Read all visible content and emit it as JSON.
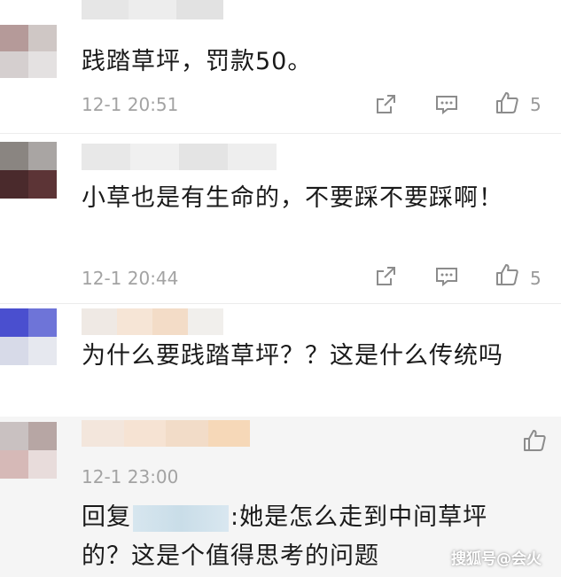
{
  "comments": [
    {
      "text": "践踏草坪，罚款50。",
      "time": "12-1 20:51",
      "like_count": "5"
    },
    {
      "text": "小草也是有生命的，不要踩不要踩啊！",
      "time": "12-1 20:44",
      "like_count": "5"
    },
    {
      "text": "为什么要践踏草坪？？这是什么传统吗"
    }
  ],
  "reply": {
    "time": "12-1 23:00",
    "prefix": "回复",
    "text": ":她是怎么走到中间草坪的？这是个值得思考的问题"
  },
  "icons": {
    "share": "share-icon",
    "comment": "comment-icon",
    "like": "thumbs-up-icon"
  },
  "colors": {
    "text": "#1a1a1a",
    "meta": "#a3a3a3",
    "icon": "#8c8c8c"
  },
  "watermark": "搜狐号@会火"
}
